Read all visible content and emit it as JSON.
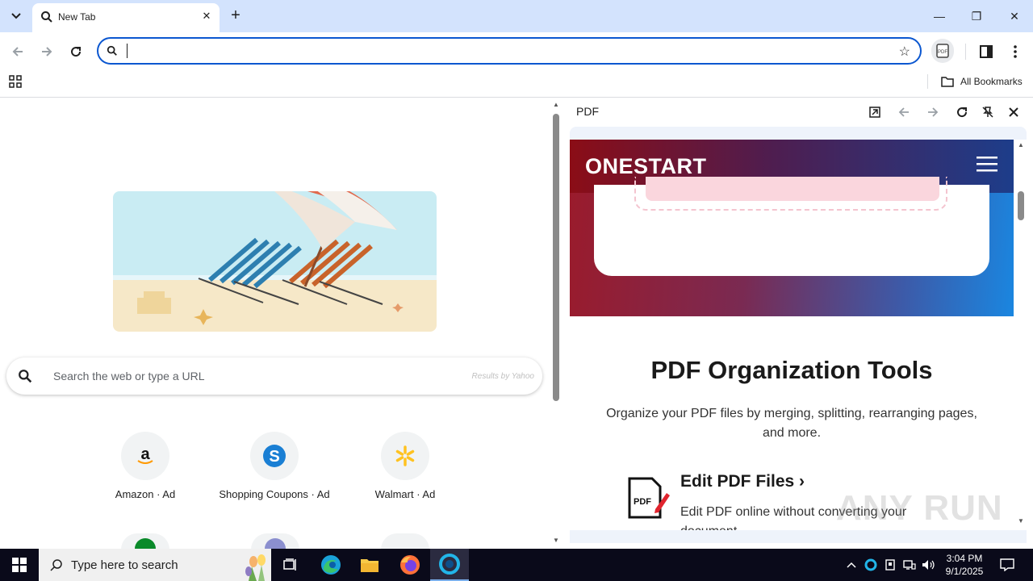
{
  "browser": {
    "tab": {
      "title": "New Tab"
    },
    "window_controls": {
      "minimize": "—",
      "restore": "❐",
      "close": "✕"
    },
    "omnibox": {
      "value": ""
    },
    "bookmarks": {
      "all_bookmarks": "All Bookmarks"
    }
  },
  "newtab": {
    "search": {
      "placeholder": "Search the web or type a URL",
      "provider": "Results by Yahoo"
    },
    "shortcuts": [
      {
        "label": "Amazon · Ad",
        "icon": "amazon-icon"
      },
      {
        "label": "Shopping Coupons · Ad",
        "icon": "shopping-coupons-icon"
      },
      {
        "label": "Walmart · Ad",
        "icon": "walmart-icon"
      }
    ]
  },
  "side_panel": {
    "title": "PDF",
    "page": {
      "logo": "ONESTART",
      "heading": "PDF Organization Tools",
      "description": "Organize your PDF files by merging, splitting, rearranging pages, and more.",
      "feature_title": "Edit PDF Files ›",
      "feature_desc": "Edit PDF online without converting your document",
      "feature_icon_text": "PDF"
    }
  },
  "watermark": "ANY RUN",
  "taskbar": {
    "search_text": "Type here to search",
    "time": "3:04 PM",
    "date": "9/1/2025"
  },
  "colors": {
    "tabstrip": "#d3e3fd",
    "omnibox_border": "#0b57d0",
    "onestart_red": "#8b0d16",
    "onestart_blue": "#1d3d8a",
    "taskbar": "#0a0a1a"
  }
}
